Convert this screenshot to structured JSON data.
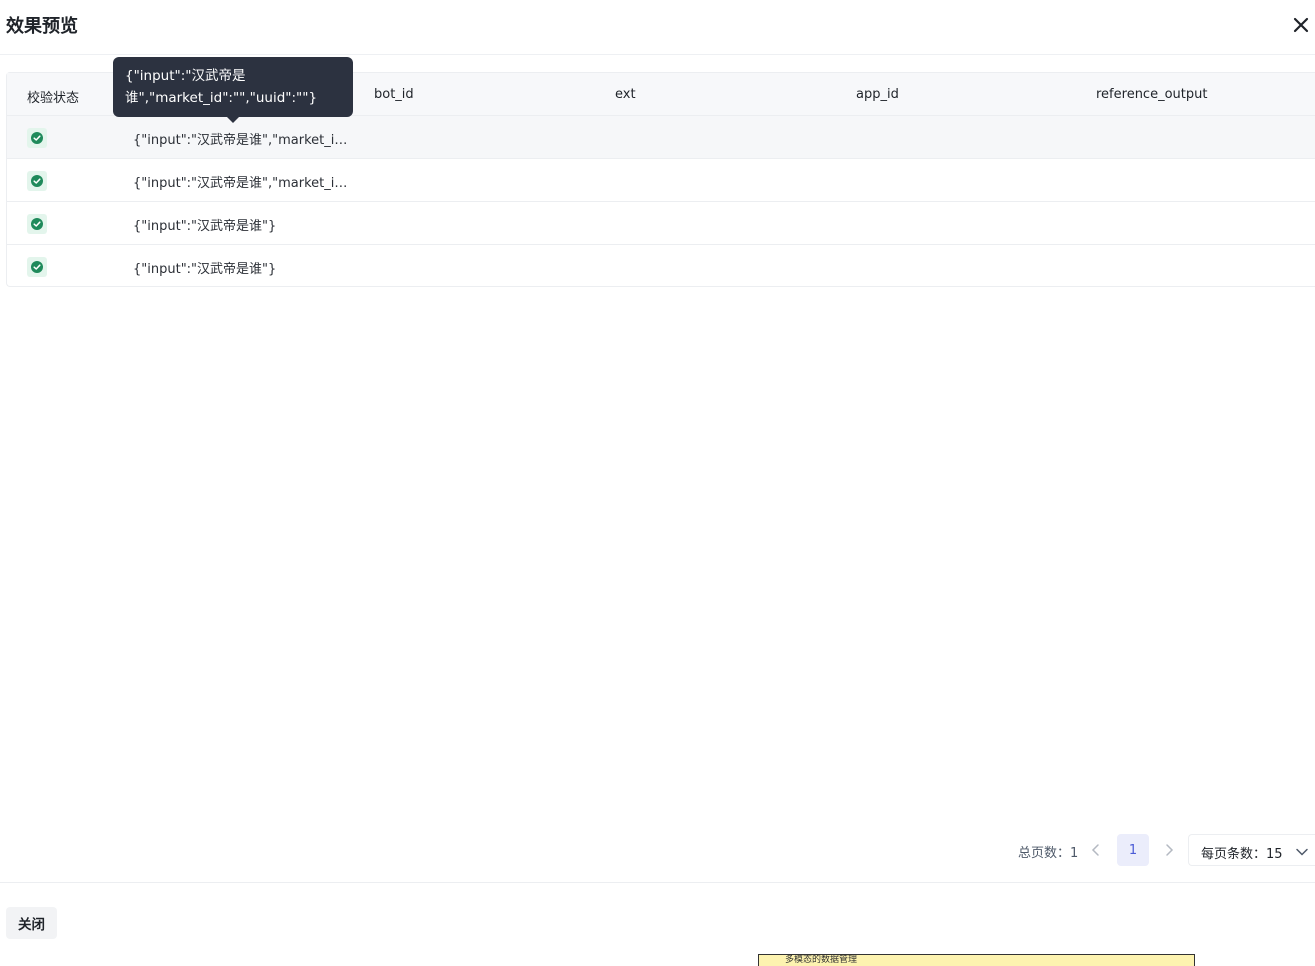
{
  "dialog": {
    "title": "效果预览",
    "close_icon": "close-icon"
  },
  "table": {
    "columns": [
      "校验状态",
      "",
      "bot_id",
      "ext",
      "app_id",
      "reference_output"
    ],
    "rows": [
      {
        "status": "check-circle-icon",
        "input": "{\"input\":\"汉武帝是谁\",\"market_i…"
      },
      {
        "status": "check-circle-icon",
        "input": "{\"input\":\"汉武帝是谁\",\"market_i…"
      },
      {
        "status": "check-circle-icon",
        "input": "{\"input\":\"汉武帝是谁\"}"
      },
      {
        "status": "check-circle-icon",
        "input": "{\"input\":\"汉武帝是谁\"}"
      }
    ],
    "status_color": "#1f8a5b"
  },
  "tooltip": {
    "line1": "{\"input\":\"汉武帝是",
    "line2": "谁\",\"market_id\":\"\",\"uuid\":\"\"}"
  },
  "pagination": {
    "total_label": "总页数：1",
    "current_page": "1",
    "per_page_label": "每页条数：15"
  },
  "footer": {
    "close_label": "关闭"
  },
  "background_note": {
    "text": "多模态的数据管理"
  },
  "colors": {
    "accent": "#4a5bd6",
    "tooltip_bg": "#2c3240",
    "success": "#1f8a5b"
  }
}
